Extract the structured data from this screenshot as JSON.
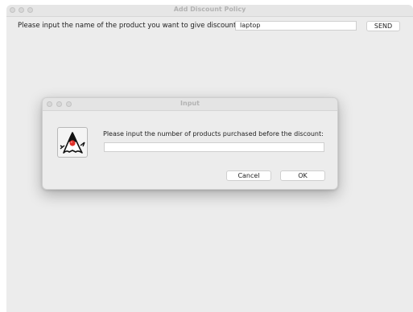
{
  "main_window": {
    "title": "Add Discount Policy",
    "prompt": "Please input the name of the product you want to give discount:",
    "product_input_value": "laptop",
    "send_label": "SEND"
  },
  "dialog": {
    "title": "Input",
    "icon": "java-duke-icon",
    "message": "Please input the number of products purchased before the discount:",
    "input_value": "",
    "cancel_label": "Cancel",
    "ok_label": "OK"
  }
}
